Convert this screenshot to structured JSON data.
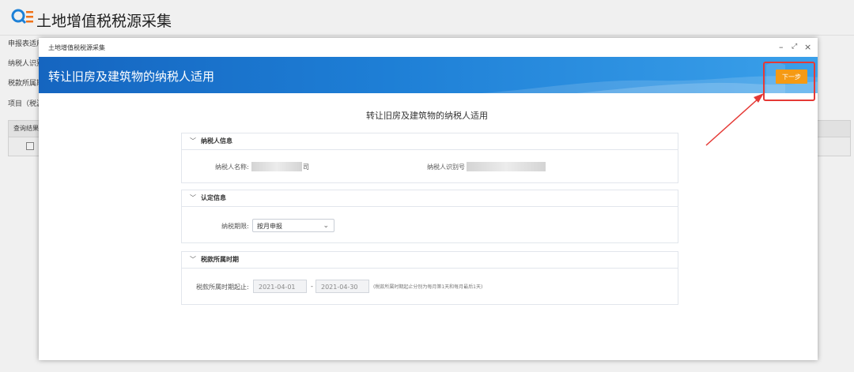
{
  "app": {
    "title": "土地增值税税源采集"
  },
  "background": {
    "labels": [
      "申报表适用",
      "纳税人识别",
      "税款所属期",
      "项目（税源"
    ],
    "table_header": "查询结果"
  },
  "modal": {
    "window_title": "土地增值税税源采集",
    "minimize": "–",
    "restore": "⤢",
    "close": "×",
    "banner_title": "转让旧房及建筑物的纳税人适用",
    "next_button": "下一步",
    "heading": "转让旧房及建筑物的纳税人适用",
    "sections": {
      "taxpayer": {
        "title": "纳税人信息",
        "name_label": "纳税人名称:",
        "name_value_suffix": "司",
        "id_label": "纳税人识别号"
      },
      "approval": {
        "title": "认定信息",
        "period_label": "纳税期限:",
        "period_value": "按月申报"
      },
      "tax_period": {
        "title": "税款所属时期",
        "range_label": "税款所属时期起止:",
        "start": "2021-04-01",
        "sep": "-",
        "end": "2021-04-30",
        "note": "(税款所属时期起止分别为每月第1天和每月最后1天)"
      }
    }
  },
  "colors": {
    "banner": "#1e7fd6",
    "button": "#f59a14",
    "highlight": "#e53935"
  }
}
